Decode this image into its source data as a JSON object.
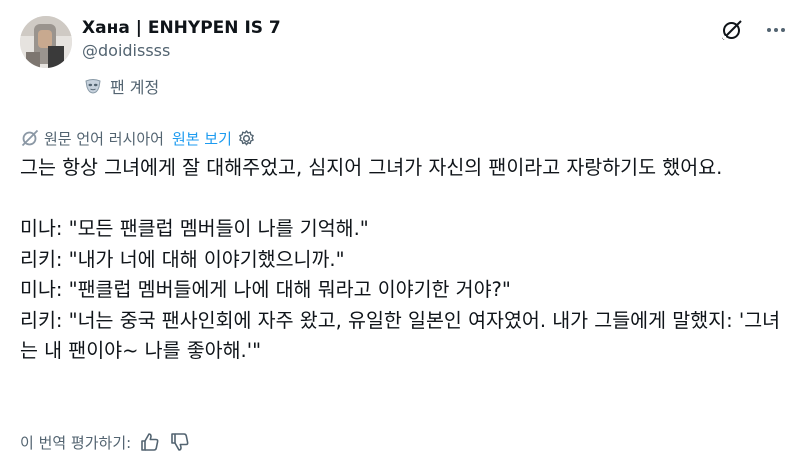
{
  "author": {
    "display_name": "Хана | ENHYPEN IS 7",
    "handle": "@doidissss",
    "fan_badge_label": "팬 계정",
    "fan_badge_icon": "mask-icon",
    "avatar_icon": "profile-photo"
  },
  "actions": {
    "grok_icon": "grok-icon",
    "more_icon": "more-options-icon"
  },
  "translation": {
    "label": "원문 언어 러시아어",
    "show_original": "원본 보기",
    "settings_icon": "gear-icon"
  },
  "tweet": {
    "paragraphs": [
      "그는 항상 그녀에게 잘 대해주었고, 심지어 그녀가 자신의 팬이라고 자랑하기도 했어요.",
      "",
      "미나: \"모든 팬클럽 멤버들이 나를 기억해.\"",
      "리키: \"내가 너에 대해 이야기했으니까.\"",
      "미나: \"팬클럽 멤버들에게 나에 대해 뭐라고 이야기한 거야?\"",
      "리키: \"너는 중국 팬사인회에 자주 왔고, 유일한 일본인 여자였어. 내가 그들에게 말했지: '그녀는 내 팬이야~ 나를 좋아해.'\""
    ]
  },
  "rating": {
    "label": "이 번역 평가하기:",
    "thumbs_up_icon": "thumbs-up-icon",
    "thumbs_down_icon": "thumbs-down-icon"
  },
  "colors": {
    "text": "#0f1419",
    "secondary": "#536471",
    "accent": "#1d9bf0"
  }
}
